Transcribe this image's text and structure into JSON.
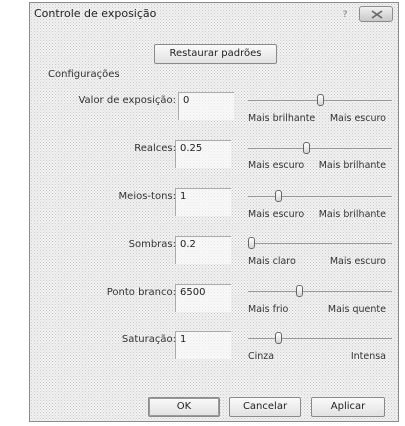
{
  "window": {
    "title": "Controle de exposição",
    "help_glyph": "?"
  },
  "restore_label": "Restaurar padrões",
  "group_label": "Configurações",
  "rows": [
    {
      "label": "Valor de exposição:",
      "value": "0",
      "left_hint": "Mais brilhante",
      "right_hint": "Mais escuro",
      "level": 0.5
    },
    {
      "label": "Realces:",
      "value": "0.25",
      "left_hint": "Mais escuro",
      "right_hint": "Mais brilhante",
      "level": 0.4
    },
    {
      "label": "Meios-tons:",
      "value": "1",
      "left_hint": "Mais escuro",
      "right_hint": "Mais brilhante",
      "level": 0.2
    },
    {
      "label": "Sombras:",
      "value": "0.2",
      "left_hint": "Mais claro",
      "right_hint": "Mais escuro",
      "level": 0.0
    },
    {
      "label": "Ponto branco:",
      "value": "6500",
      "left_hint": "Mais frio",
      "right_hint": "Mais quente",
      "level": 0.35
    },
    {
      "label": "Saturação:",
      "value": "1",
      "left_hint": "Cinza",
      "right_hint": "Intensa",
      "level": 0.2
    }
  ],
  "buttons": {
    "ok": "OK",
    "cancel": "Cancelar",
    "apply": "Aplicar"
  }
}
